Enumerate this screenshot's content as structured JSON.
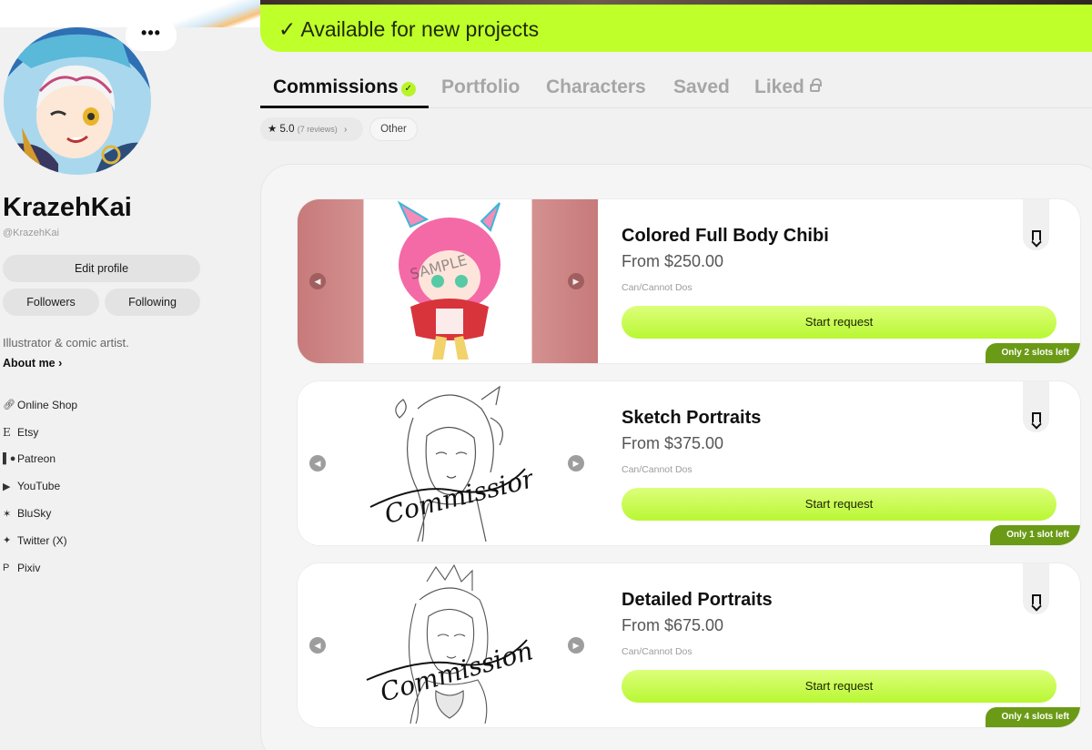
{
  "profile": {
    "more_label": "•••",
    "display_name": "KrazehKai",
    "handle": "@KrazehKai",
    "edit_profile": "Edit profile",
    "followers": "Followers",
    "following": "Following",
    "bio": "Illustrator & comic artist.",
    "about_me": "About me"
  },
  "links": [
    {
      "icon": "link-icon",
      "glyph": "🔗",
      "label": "Online Shop"
    },
    {
      "icon": "etsy-icon",
      "glyph": "E",
      "label": "Etsy"
    },
    {
      "icon": "patreon-icon",
      "glyph": "|●",
      "label": "Patreon"
    },
    {
      "icon": "youtube-icon",
      "glyph": "▶",
      "label": "YouTube"
    },
    {
      "icon": "bluesky-icon",
      "glyph": "✶",
      "label": "BluSky"
    },
    {
      "icon": "twitter-icon",
      "glyph": "✦",
      "label": "Twitter (X)"
    },
    {
      "icon": "pixiv-icon",
      "glyph": "P",
      "label": "Pixiv"
    }
  ],
  "availability": {
    "check": "✓",
    "text": "Available for new projects"
  },
  "tabs": [
    {
      "label": "Commissions",
      "active": true
    },
    {
      "label": "Portfolio",
      "active": false
    },
    {
      "label": "Characters",
      "active": false
    },
    {
      "label": "Saved",
      "active": false
    },
    {
      "label": "Liked",
      "active": false
    }
  ],
  "filters": {
    "rating": "5.0",
    "reviews": "(7 reviews)",
    "other": "Other"
  },
  "commissions": [
    {
      "title": "Colored Full Body Chibi",
      "price": "From $250.00",
      "subtitle": "Can/Cannot Dos",
      "button": "Start request",
      "slots": "Only 2 slots left"
    },
    {
      "title": "Sketch Portraits",
      "price": "From $375.00",
      "subtitle": "Can/Cannot Dos",
      "button": "Start request",
      "slots": "Only 1 slot left"
    },
    {
      "title": "Detailed Portraits",
      "price": "From $675.00",
      "subtitle": "Can/Cannot Dos",
      "button": "Start request",
      "slots": "Only 4 slots left"
    }
  ],
  "colors": {
    "accent_lime": "#bfff2a",
    "slots_green": "#6b9a16",
    "chibi_bg": "#c77a7a"
  }
}
